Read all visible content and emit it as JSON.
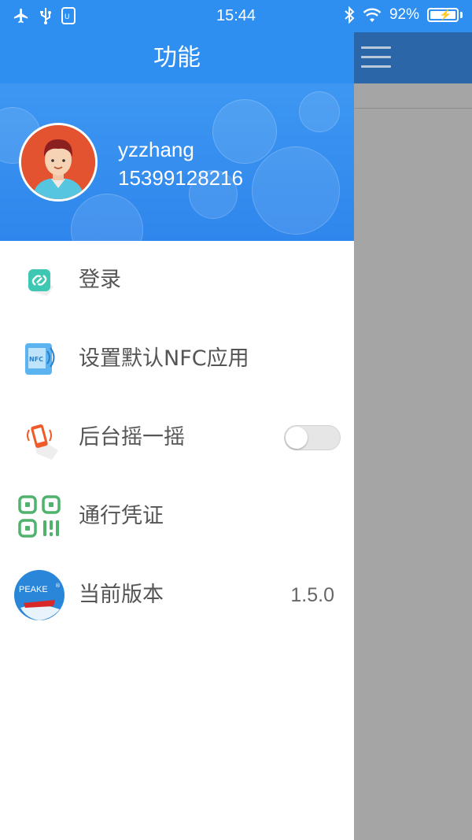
{
  "status_bar": {
    "time": "15:44",
    "battery_percent": "92%",
    "left_icons": [
      "airplane-icon",
      "usb-icon",
      "usb-debug-icon"
    ],
    "right_icons": [
      "bluetooth-icon",
      "wifi-icon",
      "battery-charging-icon"
    ]
  },
  "drawer": {
    "title": "功能",
    "profile": {
      "username": "yzzhang",
      "phone": "15399128216"
    },
    "menu": [
      {
        "label": "登录",
        "icon": "link-icon"
      },
      {
        "label": "设置默认NFC应用",
        "icon": "nfc-phone-icon"
      },
      {
        "label": "后台摇一摇",
        "icon": "shake-phone-icon",
        "toggle_on": false
      },
      {
        "label": "通行凭证",
        "icon": "qr-code-icon"
      },
      {
        "label": "当前版本",
        "icon": "app-logo-icon",
        "value": "1.5.0",
        "logo_text": "PEAKE"
      }
    ]
  },
  "main": {
    "menu_icon": "hamburger-icon"
  },
  "colors": {
    "accent": "#2e8ff0",
    "scrim": "#a6a6a6",
    "avatar_bg": "#e4532f"
  }
}
